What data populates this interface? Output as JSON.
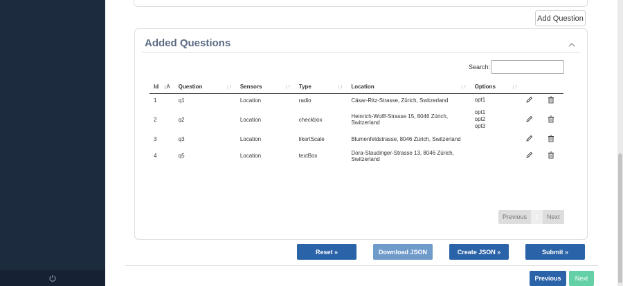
{
  "sidebar": {
    "power_icon": "power-icon"
  },
  "buttons": {
    "add_question": "Add Question",
    "reset": "Reset »",
    "download_json": "Download JSON",
    "create_json": "Create JSON »",
    "submit": "Submit »",
    "previous": "Previous",
    "next": "Next"
  },
  "panel": {
    "title": "Added Questions",
    "collapse_icon": "chevron-up-icon"
  },
  "search": {
    "label": "Search:",
    "value": ""
  },
  "table": {
    "headers": [
      "Id",
      "Question",
      "Sensors",
      "Type",
      "Location",
      "Options"
    ],
    "rows": [
      {
        "id": "1",
        "question": "q1",
        "sensors": "Location",
        "type": "radio",
        "location": "Cäsar-Ritz-Strasse, Zürich, Switzerland",
        "options": [
          "opt1"
        ]
      },
      {
        "id": "2",
        "question": "q2",
        "sensors": "Location",
        "type": "checkbox",
        "location": "Heinrich-Wolff-Strasse 15, 8046 Zürich, Switzerland",
        "options": [
          "opt1",
          "opt2",
          "opt3"
        ]
      },
      {
        "id": "3",
        "question": "q3",
        "sensors": "Location",
        "type": "likertScale",
        "location": "Blumenfeldstrasse, 8046 Zürich, Switzerland",
        "options": []
      },
      {
        "id": "4",
        "question": "q5",
        "sensors": "Location",
        "type": "textBox",
        "location": "Dora-Staudinger-Strasse 13, 8046 Zürich, Switzerland",
        "options": []
      }
    ]
  },
  "pagination": {
    "previous": "Previous",
    "current": "1",
    "next": "Next"
  },
  "colors": {
    "sidebar": "#1d2b3f",
    "primary": "#2b63a8",
    "disabled": "#6f9bcb",
    "next": "#64d0a6",
    "title": "#5b6b85"
  }
}
